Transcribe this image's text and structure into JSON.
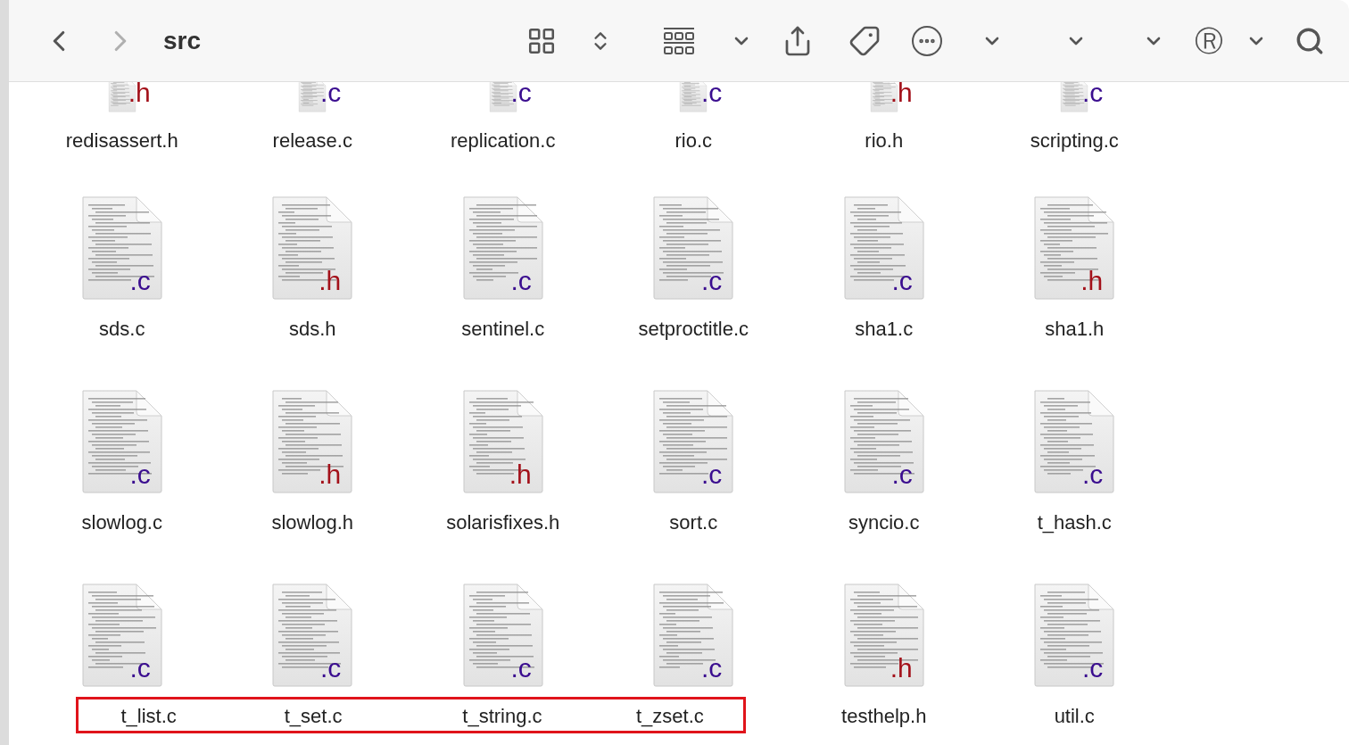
{
  "toolbar": {
    "back": {
      "disabled": false
    },
    "forward": {
      "disabled": true
    },
    "title": "src",
    "buttons": [
      {
        "kind": "grid"
      },
      {
        "kind": "updown"
      },
      {
        "kind": "group"
      },
      {
        "kind": "chevron"
      },
      {
        "kind": "share"
      },
      {
        "kind": "tag"
      },
      {
        "kind": "more"
      },
      {
        "kind": "chevron"
      },
      {
        "kind": "chevron"
      },
      {
        "kind": "chevron"
      },
      {
        "kind": "glyph",
        "text": "Ⓡ"
      },
      {
        "kind": "chevron"
      },
      {
        "kind": "search"
      }
    ]
  },
  "rows": [
    {
      "clipped": true,
      "files": [
        {
          "name": "redisassert.h",
          "badge": ".h",
          "kind": "header",
          "highlighted": false
        },
        {
          "name": "release.c",
          "badge": ".c",
          "kind": "source",
          "highlighted": false
        },
        {
          "name": "replication.c",
          "badge": ".c",
          "kind": "source",
          "highlighted": false
        },
        {
          "name": "rio.c",
          "badge": ".c",
          "kind": "source",
          "highlighted": false
        },
        {
          "name": "rio.h",
          "badge": ".h",
          "kind": "header",
          "highlighted": false
        },
        {
          "name": "scripting.c",
          "badge": ".c",
          "kind": "source",
          "highlighted": false
        }
      ]
    },
    {
      "clipped": false,
      "files": [
        {
          "name": "sds.c",
          "badge": ".c",
          "kind": "source",
          "highlighted": false
        },
        {
          "name": "sds.h",
          "badge": ".h",
          "kind": "header",
          "highlighted": false
        },
        {
          "name": "sentinel.c",
          "badge": ".c",
          "kind": "source",
          "highlighted": false
        },
        {
          "name": "setproctitle.c",
          "badge": ".c",
          "kind": "source",
          "highlighted": false
        },
        {
          "name": "sha1.c",
          "badge": ".c",
          "kind": "source",
          "highlighted": false
        },
        {
          "name": "sha1.h",
          "badge": ".h",
          "kind": "header",
          "highlighted": false
        }
      ]
    },
    {
      "clipped": false,
      "files": [
        {
          "name": "slowlog.c",
          "badge": ".c",
          "kind": "source",
          "highlighted": false
        },
        {
          "name": "slowlog.h",
          "badge": ".h",
          "kind": "header",
          "highlighted": false
        },
        {
          "name": "solarisfixes.h",
          "badge": ".h",
          "kind": "header",
          "highlighted": false
        },
        {
          "name": "sort.c",
          "badge": ".c",
          "kind": "source",
          "highlighted": false
        },
        {
          "name": "syncio.c",
          "badge": ".c",
          "kind": "source",
          "highlighted": false
        },
        {
          "name": "t_hash.c",
          "badge": ".c",
          "kind": "source",
          "highlighted": false
        }
      ]
    },
    {
      "clipped": false,
      "files": [
        {
          "name": "t_list.c",
          "badge": ".c",
          "kind": "source",
          "highlighted": true
        },
        {
          "name": "t_set.c",
          "badge": ".c",
          "kind": "source",
          "highlighted": true
        },
        {
          "name": "t_string.c",
          "badge": ".c",
          "kind": "source",
          "highlighted": true
        },
        {
          "name": "t_zset.c",
          "badge": ".c",
          "kind": "source",
          "highlighted": true
        },
        {
          "name": "testhelp.h",
          "badge": ".h",
          "kind": "header",
          "highlighted": false
        },
        {
          "name": "util.c",
          "badge": ".c",
          "kind": "source",
          "highlighted": false
        }
      ]
    }
  ]
}
